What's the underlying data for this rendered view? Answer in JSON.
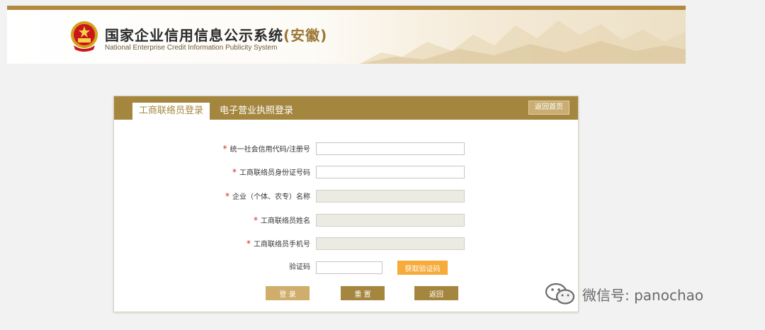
{
  "header": {
    "title_main": "国家企业信用信息公示系统",
    "title_province": "(安徽)",
    "subtitle": "National Enterprise Credit Information Publicity System",
    "emblem_icon": "national-emblem-icon"
  },
  "tabs": [
    {
      "label": "工商联络员登录",
      "active": true
    },
    {
      "label": "电子营业执照登录",
      "active": false
    }
  ],
  "home_button": "返回首页",
  "form": {
    "required_mark": "*",
    "fields": [
      {
        "label": "统一社会信用代码/注册号",
        "value": "",
        "required": true,
        "disabled": false
      },
      {
        "label": "工商联络员身份证号码",
        "value": "",
        "required": true,
        "disabled": false
      },
      {
        "label": "企业（个体、农专）名称",
        "value": "",
        "required": true,
        "disabled": true
      },
      {
        "label": "工商联络员姓名",
        "value": "",
        "required": true,
        "disabled": true
      },
      {
        "label": "工商联络员手机号",
        "value": "",
        "required": true,
        "disabled": true
      }
    ],
    "captcha": {
      "label": "验证码",
      "value": "",
      "button": "获取验证码"
    }
  },
  "actions": {
    "login": "登 录",
    "reset": "重 置",
    "back": "返回"
  },
  "watermark": {
    "text": "微信号: panochao",
    "icon": "wechat-icon"
  },
  "colors": {
    "primary": "#a5863f",
    "accent": "#f6ab3b",
    "required": "#d9261c"
  }
}
